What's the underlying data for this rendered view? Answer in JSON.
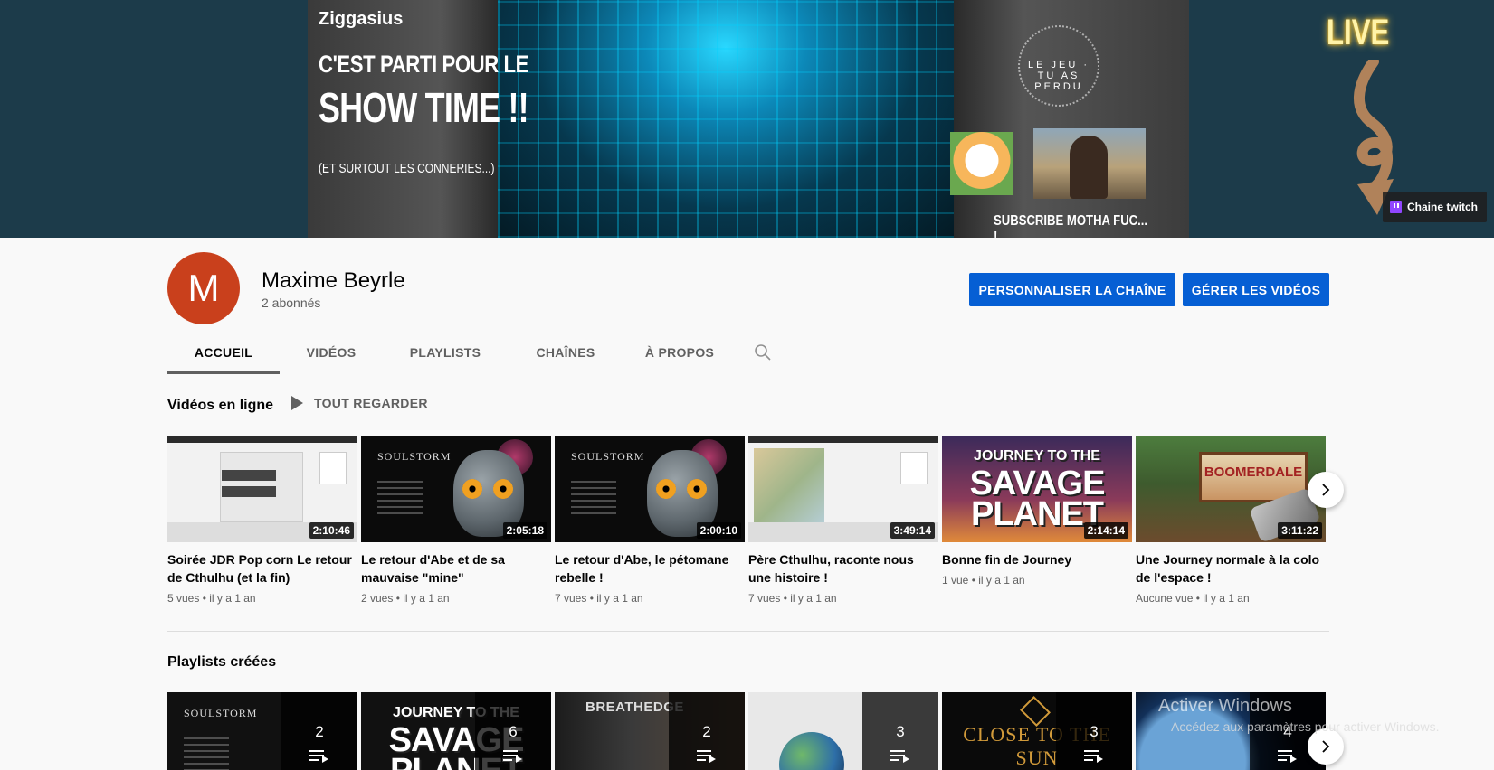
{
  "banner": {
    "brand": "Ziggasius",
    "line1": "C'EST PARTI POUR LE",
    "line2": "SHOW TIME !!",
    "line3": "(ET SURTOUT LES CONNERIES...)",
    "circle_text": "LE JEU · TU AS PERDU",
    "subscribe_text": "SUBSCRIBE MOTHA FUC... !",
    "live_text": "LIVE",
    "twitch_link_label": "Chaine twitch",
    "colors": {
      "background": "#1c3b4a",
      "live_glow": "#fff3a8",
      "arrow": "#b0825a",
      "twitch": "#9146ff"
    }
  },
  "channel": {
    "avatar_letter": "M",
    "avatar_color": "#c9401c",
    "name": "Maxime Beyrle",
    "subscribers": "2 abonnés",
    "customize_button": "PERSONNALISER LA CHAÎNE",
    "manage_button": "GÉRER LES VIDÉOS",
    "button_color": "#065fd4"
  },
  "tabs": [
    {
      "label": "ACCUEIL",
      "active": true
    },
    {
      "label": "VIDÉOS",
      "active": false
    },
    {
      "label": "PLAYLISTS",
      "active": false
    },
    {
      "label": "CHAÎNES",
      "active": false
    },
    {
      "label": "À PROPOS",
      "active": false
    }
  ],
  "uploads": {
    "title": "Vidéos en ligne",
    "play_all": "TOUT REGARDER",
    "videos": [
      {
        "title": "Soirée JDR Pop corn Le retour de Cthulhu (et la fin)",
        "duration": "2:10:46",
        "meta": "5 vues • il y a 1 an",
        "thumb": "screen"
      },
      {
        "title": "Le retour d'Abe et de sa mauvaise \"mine\"",
        "duration": "2:05:18",
        "meta": "2 vues • il y a 1 an",
        "thumb": "soulstorm"
      },
      {
        "title": "Le retour d'Abe, le pétomane rebelle !",
        "duration": "2:00:10",
        "meta": "7 vues • il y a 1 an",
        "thumb": "soulstorm"
      },
      {
        "title": "Père Cthulhu, raconte nous une histoire !",
        "duration": "3:49:14",
        "meta": "7 vues • il y a 1 an",
        "thumb": "map"
      },
      {
        "title": "Bonne fin de Journey",
        "duration": "2:14:14",
        "meta": "1 vue • il y a 1 an",
        "thumb": "savage"
      },
      {
        "title": "Une Journey normale à la colo de l'espace !",
        "duration": "3:11:22",
        "meta": "Aucune vue • il y a 1 an",
        "thumb": "boomer"
      }
    ],
    "thumb_text": {
      "soulstorm_logo": "SOULSTORM",
      "savage_line1": "JOURNEY TO THE",
      "savage_line2": "SAVAGE",
      "savage_line3": "PLANET",
      "boomer_sign": "BOOMERDALE"
    }
  },
  "playlists": {
    "title": "Playlists créées",
    "items": [
      {
        "count": "2",
        "thumb": "soulstorm"
      },
      {
        "count": "6",
        "thumb": "savage"
      },
      {
        "count": "2",
        "thumb": "breathedge"
      },
      {
        "count": "3",
        "thumb": "earth"
      },
      {
        "count": "3",
        "thumb": "closeto"
      },
      {
        "count": "4",
        "thumb": "planet"
      }
    ],
    "thumb_text": {
      "soulstorm_logo": "SOULSTORM",
      "breathedge_logo": "BREATHEDGE",
      "closeto_logo": "CLOSE TO THE SUN",
      "savage_line1": "JOURNEY TO THE",
      "savage_line2": "SAVAGE",
      "savage_line3": "PLANET"
    }
  },
  "watermark": {
    "line1": "Activer Windows",
    "line2": "Accédez aux paramètres pour activer Windows."
  }
}
